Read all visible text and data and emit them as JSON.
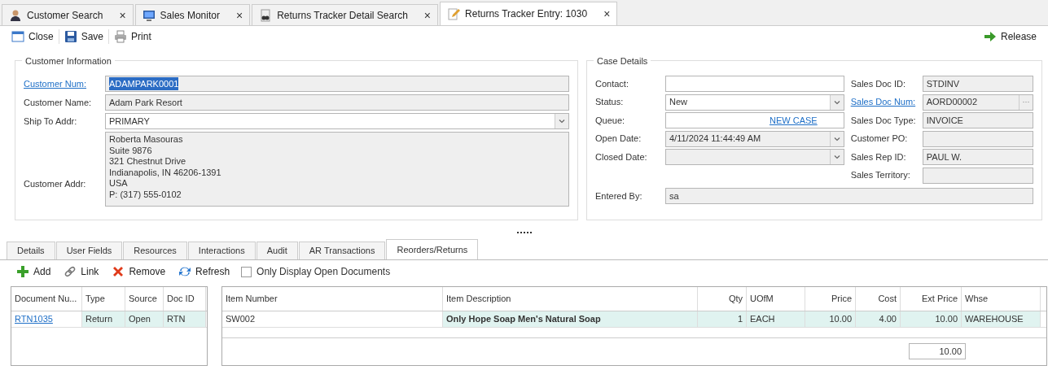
{
  "doc_tabs": [
    {
      "label": "Customer Search",
      "close": "×",
      "selected": false
    },
    {
      "label": "Sales Monitor",
      "close": "×",
      "selected": false
    },
    {
      "label": "Returns Tracker Detail Search",
      "close": "×",
      "selected": false
    },
    {
      "label": "Returns Tracker Entry: 1030",
      "close": "×",
      "selected": true
    }
  ],
  "toolbar": {
    "left": [
      {
        "label": "Close"
      },
      {
        "label": "Save"
      },
      {
        "label": "Print"
      }
    ],
    "right": [
      {
        "label": "Release"
      }
    ]
  },
  "customer_info": {
    "title": "Customer Information",
    "fields": [
      {
        "label": "Customer Num:",
        "link": true,
        "kind": "text",
        "readonly": true,
        "value": "ADAMPARK0001",
        "value_selected": true
      },
      {
        "label": "Customer Name:",
        "link": false,
        "kind": "text",
        "readonly": true,
        "value": "Adam Park Resort",
        "value_selected": false
      },
      {
        "label": "Ship To Addr:",
        "link": false,
        "kind": "select",
        "readonly": false,
        "value": "PRIMARY",
        "value_selected": false
      },
      {
        "label": "Customer Addr:",
        "link": false,
        "kind": "memo",
        "readonly": true,
        "lines": [
          "Roberta Masouras",
          "Suite 9876",
          "321 Chestnut Drive",
          "Indianapolis, IN 46206-1391",
          "USA",
          "P: (317) 555-0102"
        ]
      }
    ]
  },
  "case_details": {
    "title": "Case Details",
    "left_fields": [
      {
        "label": "Contact:",
        "kind": "text",
        "readonly": false
      },
      {
        "label": "Status:",
        "kind": "select",
        "readonly": false,
        "value": "New"
      },
      {
        "label": "Queue:",
        "kind": "linkfield",
        "readonly": false,
        "link_text": "NEW CASE"
      },
      {
        "label": "Open Date:",
        "kind": "select",
        "readonly": true,
        "value": "4/11/2024 11:44:49 AM"
      },
      {
        "label": "Closed Date:",
        "kind": "select",
        "readonly": true
      }
    ],
    "right_fields": [
      {
        "label": "Sales Doc ID:",
        "link": false,
        "kind": "text",
        "value": "STDINV"
      },
      {
        "label": "Sales Doc Num:",
        "link": true,
        "kind": "lookup",
        "value": "AORD00002",
        "button": "···"
      },
      {
        "label": "Sales Doc Type:",
        "link": false,
        "kind": "text",
        "value": "INVOICE"
      },
      {
        "label": "Customer PO:",
        "link": false,
        "kind": "text"
      },
      {
        "label": "Sales Rep ID:",
        "link": false,
        "kind": "text",
        "value": "PAUL W."
      },
      {
        "label": "Sales Territory:",
        "link": false,
        "kind": "text"
      }
    ],
    "entered_by": {
      "label": "Entered By:",
      "value": "sa"
    }
  },
  "detail_tabs": [
    {
      "label": "Details",
      "selected": false
    },
    {
      "label": "User Fields",
      "selected": false
    },
    {
      "label": "Resources",
      "selected": false
    },
    {
      "label": "Interactions",
      "selected": false
    },
    {
      "label": "Audit",
      "selected": false
    },
    {
      "label": "AR Transactions",
      "selected": false
    },
    {
      "label": "Reorders/Returns",
      "selected": true
    }
  ],
  "detail_toolbar": {
    "buttons": [
      {
        "label": "Add"
      },
      {
        "label": "Link"
      },
      {
        "label": "Remove"
      },
      {
        "label": "Refresh"
      }
    ],
    "checkbox": {
      "label": "Only Display Open Documents",
      "checked": false
    }
  },
  "documents_grid": {
    "columns": [
      {
        "label": "Document Nu...",
        "kind": "text",
        "bold": false
      },
      {
        "label": "Type",
        "kind": "text",
        "bold": false
      },
      {
        "label": "Source",
        "kind": "text",
        "bold": false
      },
      {
        "label": "Doc ID",
        "kind": "text",
        "bold": false
      }
    ],
    "rows": [
      {
        "selected": true,
        "cells": [
          "RTN1035",
          "Return",
          "Open",
          "RTN"
        ]
      }
    ]
  },
  "items_grid": {
    "columns": [
      {
        "label": "Item Number",
        "kind": "text",
        "bold": false
      },
      {
        "label": "Item Description",
        "kind": "text",
        "bold": true
      },
      {
        "label": "Qty",
        "kind": "number",
        "bold": false
      },
      {
        "label": "UOfM",
        "kind": "text",
        "bold": false
      },
      {
        "label": "Price",
        "kind": "number",
        "bold": false
      },
      {
        "label": "Cost",
        "kind": "number",
        "bold": false
      },
      {
        "label": "Ext Price",
        "kind": "number",
        "bold": false
      },
      {
        "label": "Whse",
        "kind": "text",
        "bold": false
      }
    ],
    "rows": [
      {
        "selected": true,
        "cells": [
          "SW002",
          "Only Hope Soap Men's Natural Soap",
          "1",
          "EACH",
          "10.00",
          "4.00",
          "10.00",
          "WAREHOUSE"
        ]
      }
    ],
    "total": "10.00"
  }
}
